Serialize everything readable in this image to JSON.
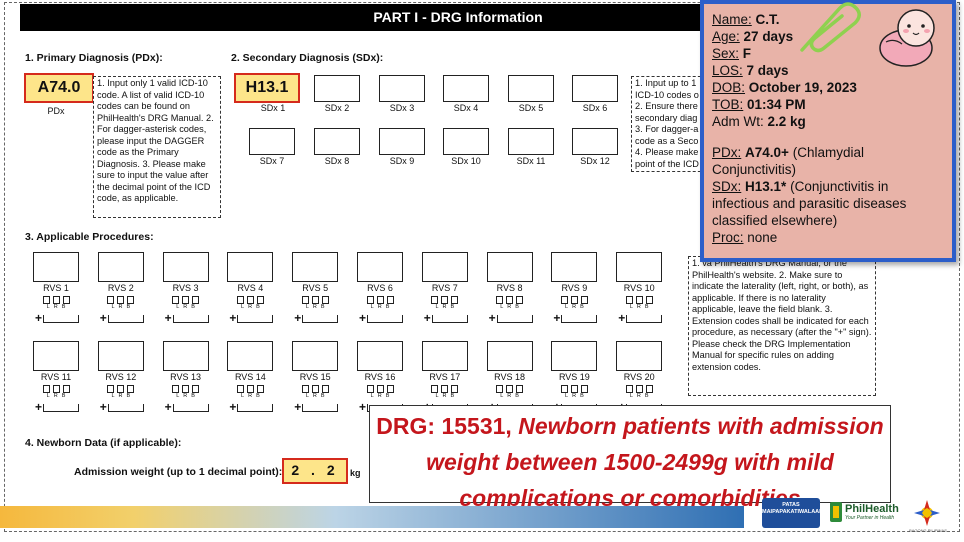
{
  "form": {
    "banner": "PART I - DRG Information",
    "primary": {
      "title": "1. Primary Diagnosis (PDx):",
      "code": "A74.0",
      "label": "PDx",
      "instructions": "1. Input only 1 valid ICD-10 code. A list of valid ICD-10 codes can be found on PhilHealth's DRG Manual. 2. For dagger-asterisk codes, please input the DAGGER code as the Primary Diagnosis. 3. Please make sure to input the value after the decimal point of the ICD code, as applicable."
    },
    "secondary": {
      "title": "2. Secondary Diagnosis (SDx):",
      "first_code": "H13.1",
      "labels": [
        "SDx 1",
        "SDx 2",
        "SDx 3",
        "SDx 4",
        "SDx 5",
        "SDx 6",
        "SDx 7",
        "SDx 8",
        "SDx 9",
        "SDx 10",
        "SDx 11",
        "SDx 12"
      ],
      "instructions": "1. Input up to 1 ICD-10 codes o 2. Ensure there secondary diag 3. For dagger-a code as a Seco 4. Please make point of the ICD"
    },
    "procedures": {
      "title": "3. Applicable Procedures:",
      "labels": [
        "RVS 1",
        "RVS 2",
        "RVS 3",
        "RVS 4",
        "RVS 5",
        "RVS 6",
        "RVS 7",
        "RVS 8",
        "RVS 9",
        "RVS 10",
        "RVS 11",
        "RVS 12",
        "RVS 13",
        "RVS 14",
        "RVS 15",
        "RVS 16",
        "RVS 17",
        "RVS 18",
        "RVS 19",
        "RVS 20"
      ],
      "laterality": [
        "L",
        "R",
        "B"
      ],
      "ext_prefix": "+",
      "instructions": "1. va PhilHealth's DRG Manual, or the PhilHealth's website. 2. Make sure to indicate the laterality (left, right, or both), as applicable. If there is no laterality applicable, leave the field blank. 3. Extension codes shall be indicated for each procedure, as necessary (after the \"+\" sign). Please check the DRG Implementation Manual for specific rules on adding extension codes."
    },
    "newborn": {
      "title": "4. Newborn Data (if applicable):",
      "weight_label": "Admission weight (up to 1 decimal point):",
      "weight_value": "2 . 2",
      "unit": "kg"
    }
  },
  "patient": {
    "name_label": "Name:",
    "name": "C.T.",
    "age_label": "Age:",
    "age": "27 days",
    "sex_label": "Sex:",
    "sex": "F",
    "los_label": "LOS:",
    "los": "7 days",
    "dob_label": "DOB:",
    "dob": "October 19, 2023",
    "tob_label": "TOB:",
    "tob": "01:34 PM",
    "admwt_label": "Adm Wt:",
    "admwt": "2.2 kg",
    "pdx_label": "PDx:",
    "pdx_code": "A74.0+",
    "pdx_desc": "(Chlamydial Conjunctivitis)",
    "sdx_label": "SDx:",
    "sdx_code": "H13.1*",
    "sdx_desc": "(Conjunctivitis in infectious and parasitic diseases classified elsewhere)",
    "proc_label": "Proc:",
    "proc": "none"
  },
  "drg": {
    "lead": "DRG: 15531, ",
    "desc": "Newborn patients with admission weight between 1500-2499g with mild complications or comorbidities"
  },
  "footer": {
    "badge": "PATAS MAIPAPAKATIWALAAN",
    "philhealth": "PhilHealth",
    "philhealth_tag": "Your Partner in Health",
    "bp_caption": "BAGONG PILIPINAS"
  },
  "colors": {
    "code_fill": "#fde58a",
    "code_border": "#d52a1c",
    "card_fill": "#e8b3a8",
    "card_border": "#2c5ec9",
    "drg_text": "#c4161c"
  },
  "icons": [
    "paperclip-icon",
    "baby-illustration",
    "bagong-pilipinas-logo",
    "philhealth-logo"
  ]
}
